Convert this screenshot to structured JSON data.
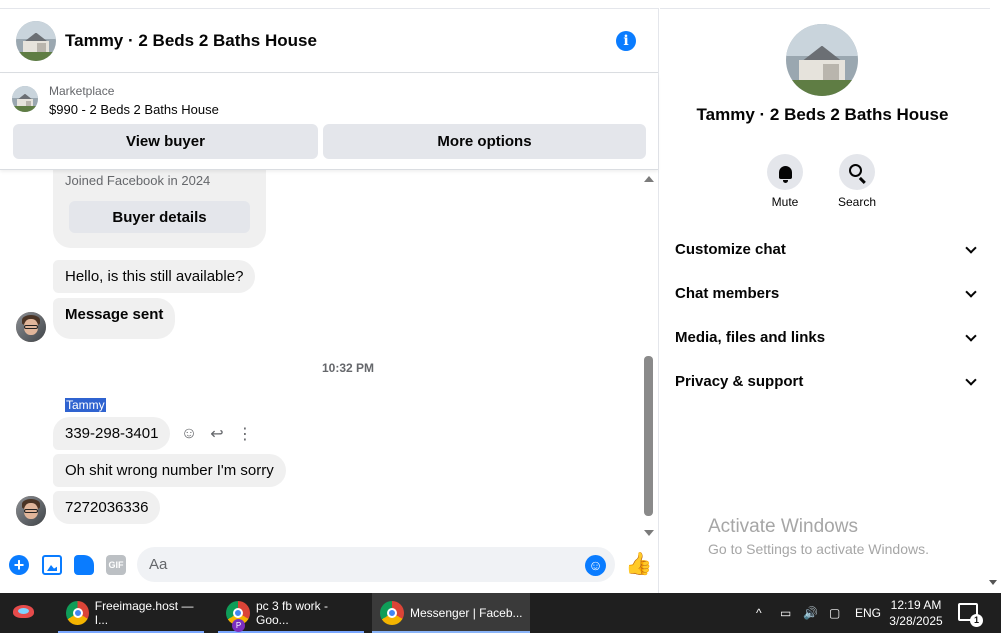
{
  "chat": {
    "header_title": "Tammy · 2 Beds 2 Baths House",
    "marketplace_label": "Marketplace",
    "marketplace_listing": "$990 - 2 Beds 2 Baths House",
    "view_buyer_label": "View buyer",
    "more_options_label": "More options",
    "card_joined": "Joined Facebook in 2024",
    "buyer_details_label": "Buyer details",
    "messages": [
      "Hello, is this still available?",
      "Message sent",
      "339-298-3401",
      "Oh shit wrong number I'm sorry",
      "7272036336"
    ],
    "time_separator": "10:32 PM",
    "sender_name": "Tammy",
    "composer_placeholder": "Aa"
  },
  "info": {
    "title": "Tammy · 2 Beds 2 Baths House",
    "mute_label": "Mute",
    "search_label": "Search",
    "sections": [
      "Customize chat",
      "Chat members",
      "Media, files and links",
      "Privacy & support"
    ]
  },
  "watermark": {
    "line1": "Activate Windows",
    "line2": "Go to Settings to activate Windows."
  },
  "taskbar": {
    "items": [
      "Freeimage.host — I...",
      "pc 3 fb work - Goo...",
      "Messenger | Faceb..."
    ],
    "badge_p": "P",
    "language": "ENG",
    "time": "12:19 AM",
    "date": "3/28/2025",
    "notification_count": "1"
  },
  "colors": {
    "accent": "#0a7cff",
    "bubble": "#f0f0f0",
    "button": "#e4e6eb",
    "taskbar": "#1f1f1f"
  }
}
